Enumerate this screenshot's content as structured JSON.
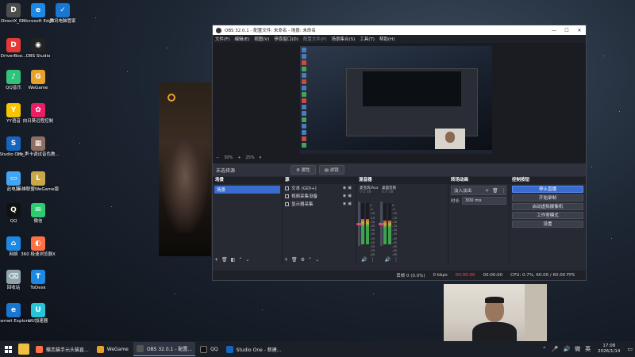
{
  "desktop": {
    "icons": [
      {
        "label": "DirectX_R...",
        "color": "#4d4d4d",
        "glyph": "D"
      },
      {
        "label": "Microsoft Edge",
        "color": "#1e88e5",
        "glyph": "e"
      },
      {
        "label": "腾讯电脑管家",
        "color": "#1976d2",
        "glyph": "✓"
      },
      {
        "label": "DriverBoo...",
        "color": "#e53935",
        "glyph": "D"
      },
      {
        "label": "OBS Studio",
        "color": "#222222",
        "glyph": "◉"
      },
      {
        "label": "QQ音乐",
        "color": "#31c27c",
        "glyph": "♪"
      },
      {
        "label": "WeGame",
        "color": "#e8a12a",
        "glyph": "G"
      },
      {
        "label": "YY语音",
        "color": "#f9c400",
        "glyph": "Y"
      },
      {
        "label": "向日葵远程控制",
        "color": "#e91e63",
        "glyph": "✿"
      },
      {
        "label": "Studio One 7",
        "color": "#1565c0",
        "glyph": "S"
      },
      {
        "label": "05_声卡调试音色教...",
        "color": "#8d6e63",
        "glyph": "▦"
      },
      {
        "label": "此电脑",
        "color": "#42a5f5",
        "glyph": "▭"
      },
      {
        "label": "英雄联盟WeGame版",
        "color": "#c9a84a",
        "glyph": "L"
      },
      {
        "label": "QQ",
        "color": "#111111",
        "glyph": "Q"
      },
      {
        "label": "微信",
        "color": "#2ecc71",
        "glyph": "✉"
      },
      {
        "label": "网络",
        "color": "#1e88e5",
        "glyph": "⌂"
      },
      {
        "label": "360 极速浏览器X",
        "color": "#ff7043",
        "glyph": "◐"
      },
      {
        "label": "回收站",
        "color": "#90a4ae",
        "glyph": "⌫"
      },
      {
        "label": "ToDesk",
        "color": "#1e88e5",
        "glyph": "T"
      },
      {
        "label": "Internet Explorer",
        "color": "#1976d2",
        "glyph": "e"
      },
      {
        "label": "UU加速器",
        "color": "#26c6da",
        "glyph": "U"
      }
    ]
  },
  "obs": {
    "title": "OBS 32.0.1 - 配置文件: 未命名 - 场景: 未命名",
    "menu": [
      "文件(F)",
      "编辑(E)",
      "视图(V)",
      "停靠窗口(D)",
      "配置文件(P)",
      "场景集合(S)",
      "工具(T)",
      "帮助(H)"
    ],
    "zoom_label": "30%",
    "zoom_value": "25%",
    "src_toolbar": {
      "none_selected": "未选择源",
      "properties": "属性",
      "filters": "滤镜"
    },
    "docks": {
      "scenes": {
        "title": "场景",
        "items": [
          "场景"
        ]
      },
      "sources": {
        "title": "源",
        "items": [
          "文本 (GDI+)",
          "视频采集设备",
          "显示器采集"
        ]
      },
      "mixer": {
        "title": "混音器",
        "channels": [
          {
            "name": "麦克风/Aux",
            "db": "0.0 dB",
            "level": 0.62,
            "fader": 0.5
          },
          {
            "name": "桌面音频",
            "db": "0.0 dB",
            "level": 0.58,
            "fader": 0.5
          }
        ],
        "scale": [
          "0",
          "-5",
          "-10",
          "-15",
          "-20",
          "-25",
          "-30",
          "-35",
          "-40",
          "-45",
          "-50",
          "-55",
          "-60"
        ]
      },
      "transitions": {
        "title": "转场动画",
        "selected": "淡入淡出",
        "duration_label": "时长",
        "duration_value": "300 ms"
      },
      "controls": {
        "title": "控制按钮",
        "buttons": [
          "停止直播",
          "开始录制",
          "启动虚拟摄像机",
          "工作室模式",
          "设置"
        ]
      }
    },
    "status": {
      "dropped": "丢帧 0 (0.0%)",
      "bitrate": "0 kbps",
      "live_time": "00:00:00",
      "rec_time": "00:00:00",
      "cpu": "CPU: 0.7%, 60.00 / 60.00 FPS"
    }
  },
  "taskbar": {
    "apps": [
      {
        "label": "蝶恋猫手元头猫直...",
        "color": "#ff7043"
      },
      {
        "label": "WeGame",
        "color": "#e8a12a"
      },
      {
        "label": "OBS 32.0.1 - 配置...",
        "color": "#333333"
      },
      {
        "label": "QQ",
        "color": "#111111"
      },
      {
        "label": "Studio One - 新建...",
        "color": "#1565c0"
      }
    ],
    "tray": {
      "lang": "微",
      "input": "英",
      "time": "17:08",
      "date": "2026/1/14"
    }
  }
}
